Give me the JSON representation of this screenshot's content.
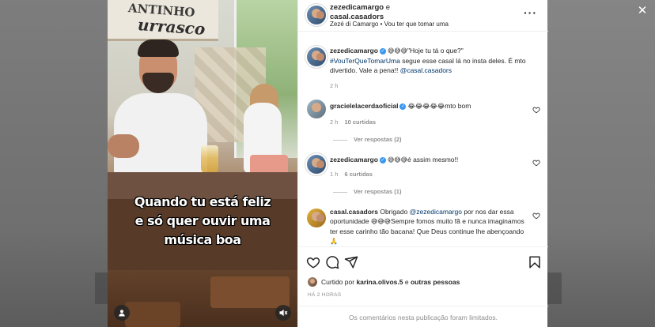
{
  "post": {
    "author": "zezedicamargo",
    "joiner": " e",
    "coauthor": "casal.casadors",
    "subtitle_artist": "Zezé di Camargo",
    "subtitle_sep": " • ",
    "subtitle_song": "Vou ter que tomar uma"
  },
  "video": {
    "sign_line1": "ANTINHO",
    "sign_line2": "urrasco",
    "caption": [
      "Quando tu está feliz",
      "e só quer ouvir uma",
      "música boa"
    ]
  },
  "caption_comment": {
    "user": "zezedicamargo",
    "emojis": "😅😅😅",
    "quote": "\"Hoje tu tá o que?\"",
    "hashtag": "#VouTerQueTomarUma",
    "text": " segue esse casal lá no insta deles. É mto divertido. Vale a pena!! ",
    "mention": "@casal.casadors",
    "time": "2 h"
  },
  "comments": [
    {
      "user": "gracielelacerdaoficial",
      "emojis": "😂😂😂😂😂",
      "text": "mto bom",
      "time": "2 h",
      "likes": "10 curtidas",
      "replies": "Ver respostas (2)"
    },
    {
      "user": "zezedicamargo",
      "emojis": "😅😅😅",
      "text": "é assim mesmo!!",
      "time": "1 h",
      "likes": "6 curtidas",
      "replies": "Ver respostas (1)"
    },
    {
      "user": "casal.casadors",
      "pre": " Obrigado ",
      "mention": "@zezedicamargo",
      "text_a": " por nos dar essa oportunidade ",
      "emojis": "😅😅😅",
      "text_b": "Sempre fomos muito fã e nunca imaginamos ter esse carinho tão bacana! Que Deus continue lhe abençoando ",
      "emoji_end": "🙏"
    }
  ],
  "likes": {
    "prefix": "Curtido por ",
    "user": "karina.olivos.5",
    "suffix": " e ",
    "others": "outras pessoas"
  },
  "time_ago": "HÁ 2 HORAS",
  "comments_limited": "Os comentários nesta publicação foram limitados.",
  "icons": {
    "close": "close-icon",
    "more": "more-options-icon",
    "like": "heart-icon",
    "comment": "comment-icon",
    "share": "share-icon",
    "save": "bookmark-icon",
    "mute": "speaker-muted-icon",
    "user": "user-tag-icon"
  },
  "colors": {
    "link": "#00376b",
    "verified": "#3897f0",
    "meta": "#8e8e8e",
    "text": "#262626"
  }
}
